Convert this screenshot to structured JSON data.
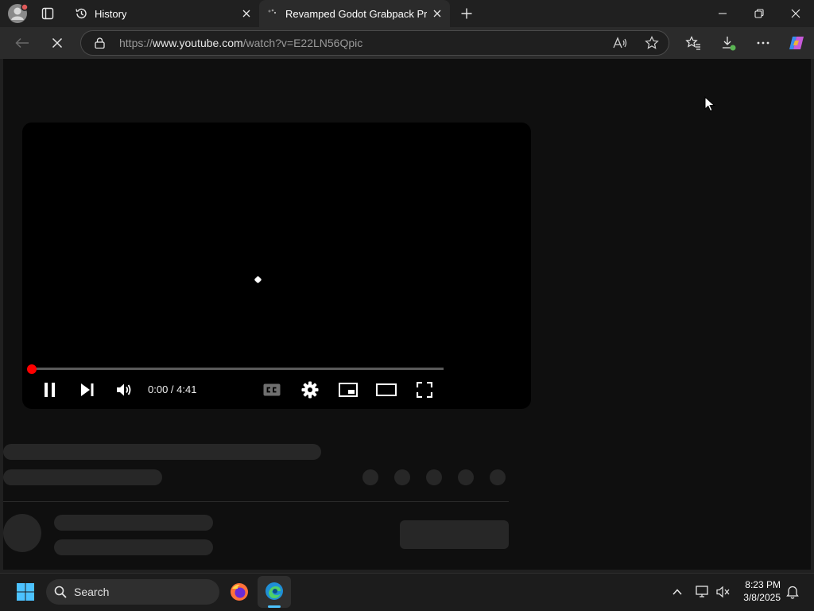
{
  "browser": {
    "tabs": [
      {
        "title": "History",
        "icon": "history-icon"
      },
      {
        "title": "Revamped Godot Grabpack Proje",
        "icon": "loading-favicon",
        "active": true
      }
    ],
    "url": {
      "scheme": "https://",
      "host": "www.youtube.com",
      "path": "/watch?v=E22LN56Qpic"
    }
  },
  "player": {
    "time_display": "0:00 / 4:41",
    "current_time": "0:00",
    "duration": "4:41",
    "progress_fraction": 0.0,
    "accent_color": "#ff0000",
    "state": "playing"
  },
  "taskbar": {
    "search_label": "Search",
    "time": "8:23 PM",
    "date": "3/8/2025"
  }
}
